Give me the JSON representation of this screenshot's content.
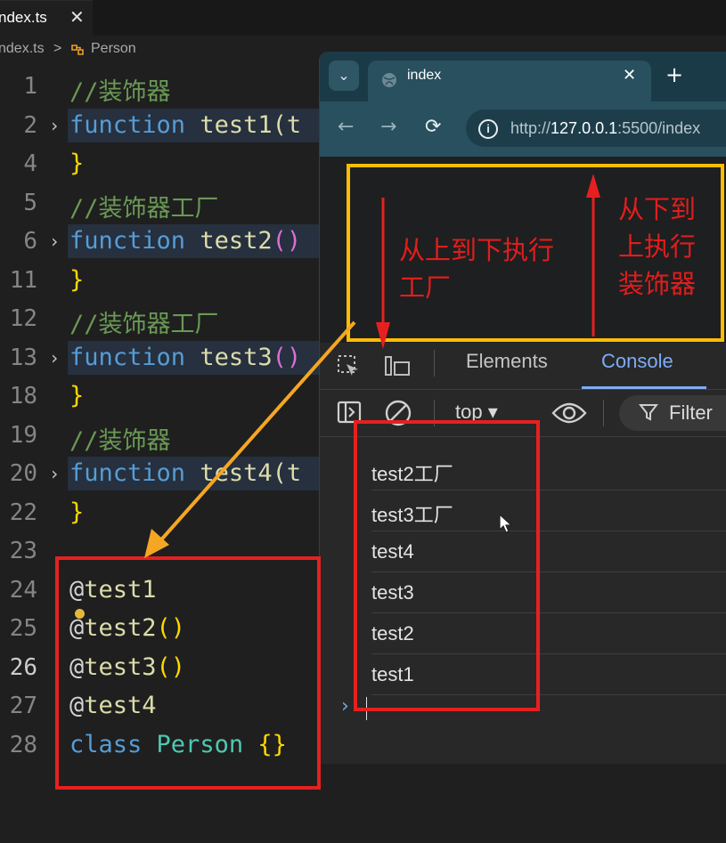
{
  "editor": {
    "tab": {
      "filename": "ndex.ts",
      "close": "✕"
    },
    "breadcrumb": {
      "file": "ndex.ts",
      "separator": ">",
      "symbol": "Person"
    },
    "lines": [
      {
        "no": "1",
        "parts": [
          {
            "t": "//装饰器",
            "c": "comment"
          }
        ]
      },
      {
        "no": "2",
        "fold": true,
        "hl": true,
        "parts": [
          {
            "t": "function",
            "c": "kw"
          },
          {
            "t": " ",
            "c": "at"
          },
          {
            "t": "test1",
            "c": "fn"
          },
          {
            "t": "(t",
            "c": "fn"
          }
        ]
      },
      {
        "no": "4",
        "parts": [
          {
            "t": "}",
            "c": "brace"
          }
        ]
      },
      {
        "no": "5",
        "parts": [
          {
            "t": "//装饰器工厂",
            "c": "comment"
          }
        ]
      },
      {
        "no": "6",
        "fold": true,
        "hl": true,
        "parts": [
          {
            "t": "function",
            "c": "kw"
          },
          {
            "t": " ",
            "c": "at"
          },
          {
            "t": "test2",
            "c": "fn"
          },
          {
            "t": "()",
            "c": "paren"
          }
        ]
      },
      {
        "no": "11",
        "parts": [
          {
            "t": "}",
            "c": "brace"
          }
        ]
      },
      {
        "no": "12",
        "parts": [
          {
            "t": "//装饰器工厂",
            "c": "comment"
          }
        ]
      },
      {
        "no": "13",
        "fold": true,
        "hl": true,
        "parts": [
          {
            "t": "function",
            "c": "kw"
          },
          {
            "t": " ",
            "c": "at"
          },
          {
            "t": "test3",
            "c": "fn"
          },
          {
            "t": "()",
            "c": "paren"
          }
        ]
      },
      {
        "no": "18",
        "parts": [
          {
            "t": "}",
            "c": "brace"
          }
        ]
      },
      {
        "no": "19",
        "parts": [
          {
            "t": "//装饰器",
            "c": "comment"
          }
        ]
      },
      {
        "no": "20",
        "fold": true,
        "hl": true,
        "parts": [
          {
            "t": "function",
            "c": "kw"
          },
          {
            "t": " ",
            "c": "at"
          },
          {
            "t": "test4",
            "c": "fn"
          },
          {
            "t": "(t",
            "c": "fn"
          }
        ]
      },
      {
        "no": "22",
        "parts": [
          {
            "t": "}",
            "c": "brace"
          }
        ]
      },
      {
        "no": "23",
        "parts": []
      },
      {
        "no": "24",
        "parts": [
          {
            "t": "@",
            "c": "at"
          },
          {
            "t": "test1",
            "c": "deco"
          }
        ]
      },
      {
        "no": "25",
        "parts": [
          {
            "t": "@",
            "c": "at"
          },
          {
            "t": "test2",
            "c": "deco"
          },
          {
            "t": "()",
            "c": "brace"
          }
        ]
      },
      {
        "no": "26",
        "active": true,
        "parts": [
          {
            "t": "@",
            "c": "at"
          },
          {
            "t": "test3",
            "c": "deco"
          },
          {
            "t": "()",
            "c": "brace"
          }
        ]
      },
      {
        "no": "27",
        "parts": [
          {
            "t": "@",
            "c": "at"
          },
          {
            "t": "test4",
            "c": "deco"
          }
        ]
      },
      {
        "no": "28",
        "parts": [
          {
            "t": "class",
            "c": "kw"
          },
          {
            "t": " ",
            "c": "at"
          },
          {
            "t": "Person",
            "c": "cls"
          },
          {
            "t": " ",
            "c": "at"
          },
          {
            "t": "{}",
            "c": "brace"
          }
        ]
      }
    ]
  },
  "browser": {
    "tab_title": "index",
    "tab_close": "✕",
    "new_tab": "+",
    "url_prefix": "http://",
    "url_host": "127.0.0.1",
    "url_rest": ":5500/index",
    "devtools": {
      "tabs": {
        "elements": "Elements",
        "console": "Console"
      },
      "context": "top ▾",
      "filter": "Filter",
      "logs": [
        "test2工厂",
        "test3工厂",
        "test4",
        "test3",
        "test2",
        "test1"
      ],
      "prompt": "›"
    }
  },
  "annotations": {
    "top_down": "从上到下执行工厂",
    "top_down_lines": [
      "从上到下执行",
      "工厂"
    ],
    "bottom_up_lines": [
      "从下到",
      "上执行",
      "装饰器"
    ],
    "colors": {
      "red": "#e11d1d",
      "yellow": "#fbbc05",
      "orange": "#f5a623"
    }
  }
}
